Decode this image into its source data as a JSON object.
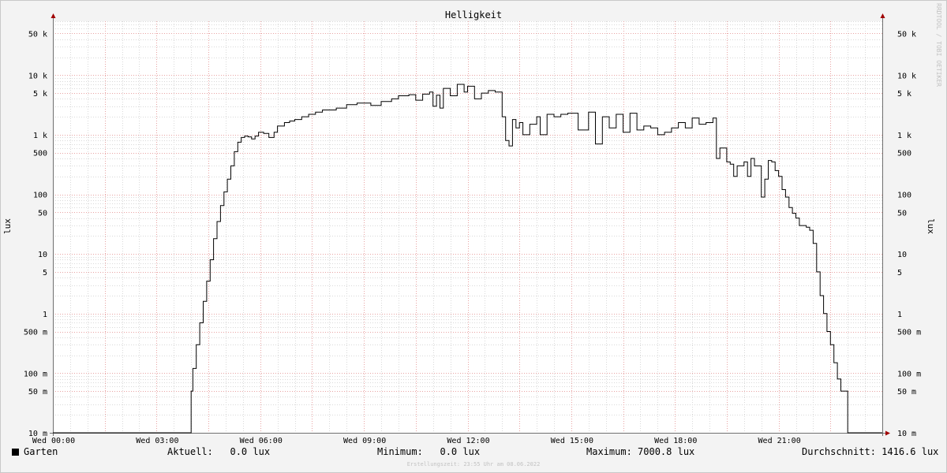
{
  "chart_data": {
    "type": "line",
    "title": "Helligkeit",
    "ylabel": "lux",
    "y_scale": "log",
    "ylim": [
      0.01,
      80000
    ],
    "y_ticks": [
      {
        "value": 0.01,
        "label": "10 m"
      },
      {
        "value": 0.05,
        "label": "50 m"
      },
      {
        "value": 0.1,
        "label": "100 m"
      },
      {
        "value": 0.5,
        "label": "500 m"
      },
      {
        "value": 1,
        "label": "1"
      },
      {
        "value": 5,
        "label": "5"
      },
      {
        "value": 10,
        "label": "10"
      },
      {
        "value": 50,
        "label": "50"
      },
      {
        "value": 100,
        "label": "100"
      },
      {
        "value": 500,
        "label": "500"
      },
      {
        "value": 1000,
        "label": "1 k"
      },
      {
        "value": 5000,
        "label": "5 k"
      },
      {
        "value": 10000,
        "label": "10 k"
      },
      {
        "value": 50000,
        "label": "50 k"
      }
    ],
    "xlim": [
      "00:00",
      "24:00"
    ],
    "x_ticks": [
      {
        "value": 0,
        "label": "Wed 00:00"
      },
      {
        "value": 3,
        "label": "Wed 03:00"
      },
      {
        "value": 6,
        "label": "Wed 06:00"
      },
      {
        "value": 9,
        "label": "Wed 09:00"
      },
      {
        "value": 12,
        "label": "Wed 12:00"
      },
      {
        "value": 15,
        "label": "Wed 15:00"
      },
      {
        "value": 18,
        "label": "Wed 18:00"
      },
      {
        "value": 21,
        "label": "Wed 21:00"
      }
    ],
    "grid": true,
    "series": [
      {
        "name": "Garten",
        "color": "#000000",
        "x_hours": [
          0,
          4.0,
          4.05,
          4.15,
          4.25,
          4.35,
          4.45,
          4.55,
          4.65,
          4.75,
          4.85,
          4.95,
          5.05,
          5.15,
          5.25,
          5.35,
          5.45,
          5.55,
          5.65,
          5.75,
          5.85,
          5.95,
          6.1,
          6.25,
          6.4,
          6.5,
          6.7,
          6.85,
          7.0,
          7.2,
          7.4,
          7.6,
          7.8,
          8.0,
          8.2,
          8.5,
          8.8,
          9.2,
          9.5,
          9.8,
          10.0,
          10.3,
          10.5,
          10.7,
          10.9,
          11.0,
          11.1,
          11.2,
          11.3,
          11.5,
          11.7,
          11.9,
          12.0,
          12.2,
          12.4,
          12.6,
          12.8,
          13.0,
          13.1,
          13.2,
          13.3,
          13.4,
          13.5,
          13.6,
          13.8,
          14.0,
          14.1,
          14.3,
          14.5,
          14.7,
          14.9,
          15.2,
          15.5,
          15.7,
          15.9,
          16.1,
          16.3,
          16.5,
          16.7,
          16.9,
          17.1,
          17.3,
          17.5,
          17.7,
          17.9,
          18.1,
          18.3,
          18.5,
          18.7,
          18.9,
          19.1,
          19.2,
          19.3,
          19.5,
          19.6,
          19.7,
          19.8,
          20.0,
          20.1,
          20.2,
          20.3,
          20.5,
          20.6,
          20.7,
          20.8,
          20.9,
          21.0,
          21.1,
          21.2,
          21.3,
          21.4,
          21.5,
          21.6,
          21.8,
          21.9,
          22.0,
          22.1,
          22.2,
          22.3,
          22.4,
          22.5,
          22.6,
          22.7,
          22.8,
          22.9,
          23.0,
          23.5,
          24.0
        ],
        "y_lux": [
          0.01,
          0.05,
          0.12,
          0.3,
          0.7,
          1.6,
          3.5,
          8,
          18,
          35,
          65,
          110,
          180,
          300,
          520,
          750,
          900,
          950,
          920,
          850,
          950,
          1100,
          1050,
          900,
          1100,
          1400,
          1600,
          1700,
          1800,
          2000,
          2200,
          2400,
          2600,
          2600,
          2800,
          3200,
          3400,
          3100,
          3600,
          4000,
          4500,
          4700,
          3800,
          4800,
          5200,
          3000,
          4600,
          2800,
          6000,
          4500,
          7000,
          5200,
          6500,
          4000,
          5000,
          5500,
          5200,
          2000,
          800,
          650,
          1800,
          1300,
          1600,
          1000,
          1500,
          2000,
          1000,
          2200,
          2000,
          2200,
          2300,
          1200,
          2400,
          700,
          2000,
          1300,
          2200,
          1100,
          2300,
          1200,
          1400,
          1300,
          1000,
          1100,
          1300,
          1600,
          1300,
          1900,
          1500,
          1600,
          1900,
          400,
          600,
          350,
          320,
          200,
          300,
          350,
          200,
          400,
          300,
          90,
          180,
          370,
          350,
          250,
          200,
          120,
          90,
          60,
          48,
          40,
          30,
          28,
          25,
          15,
          5,
          2,
          1,
          0.5,
          0.3,
          0.15,
          0.08,
          0.05,
          0.05,
          0.01,
          0.01,
          0.01,
          0.01
        ]
      }
    ]
  },
  "legend": {
    "series_name": "Garten",
    "aktuell": "Aktuell:   0.0 lux",
    "minimum": "Minimum:   0.0 lux",
    "maximum": "Maximum: 7000.8 lux",
    "durchschnitt": "Durchschnitt: 1416.6 lux"
  },
  "credit": "RRDTOOL / TOBI OETIKER",
  "footer": "Erstellungszeit: 23:55 Uhr am 08.06.2022",
  "colors": {
    "background": "#f3f3f3",
    "plot": "#ffffff",
    "grid_major": "#e8a3a3",
    "grid_minor": "#d9d9d9",
    "axis": "#707070",
    "arrow": "#a00000",
    "line": "#000000"
  }
}
